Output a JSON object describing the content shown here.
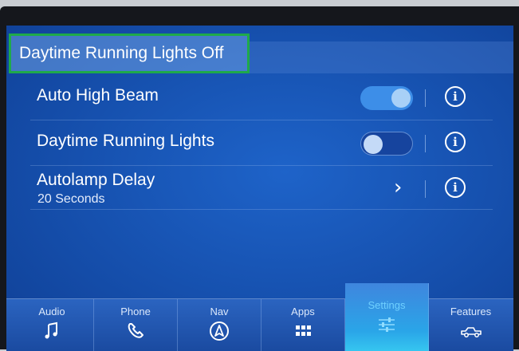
{
  "banner": {
    "text": "Daytime Running Lights Off"
  },
  "settings": [
    {
      "label": "Auto High Beam",
      "control": "toggle",
      "state": "on"
    },
    {
      "label": "Daytime Running Lights",
      "control": "toggle",
      "state": "off"
    },
    {
      "label": "Autolamp Delay",
      "value": "20 Seconds",
      "control": "chevron"
    }
  ],
  "icons": {
    "info": "i",
    "chevron": "›"
  },
  "nav": {
    "tabs": [
      {
        "label": "Audio",
        "icon": "music-note-icon"
      },
      {
        "label": "Phone",
        "icon": "phone-icon"
      },
      {
        "label": "Nav",
        "icon": "navigation-arrow-icon"
      },
      {
        "label": "Apps",
        "icon": "apps-grid-icon"
      },
      {
        "label": "Settings",
        "icon": "sliders-icon",
        "active": true
      },
      {
        "label": "Features",
        "icon": "vehicle-icon"
      }
    ]
  },
  "colors": {
    "accent": "#3d8ee8",
    "highlight": "#1faa4a",
    "active_tab_text": "#6fd0ff"
  }
}
